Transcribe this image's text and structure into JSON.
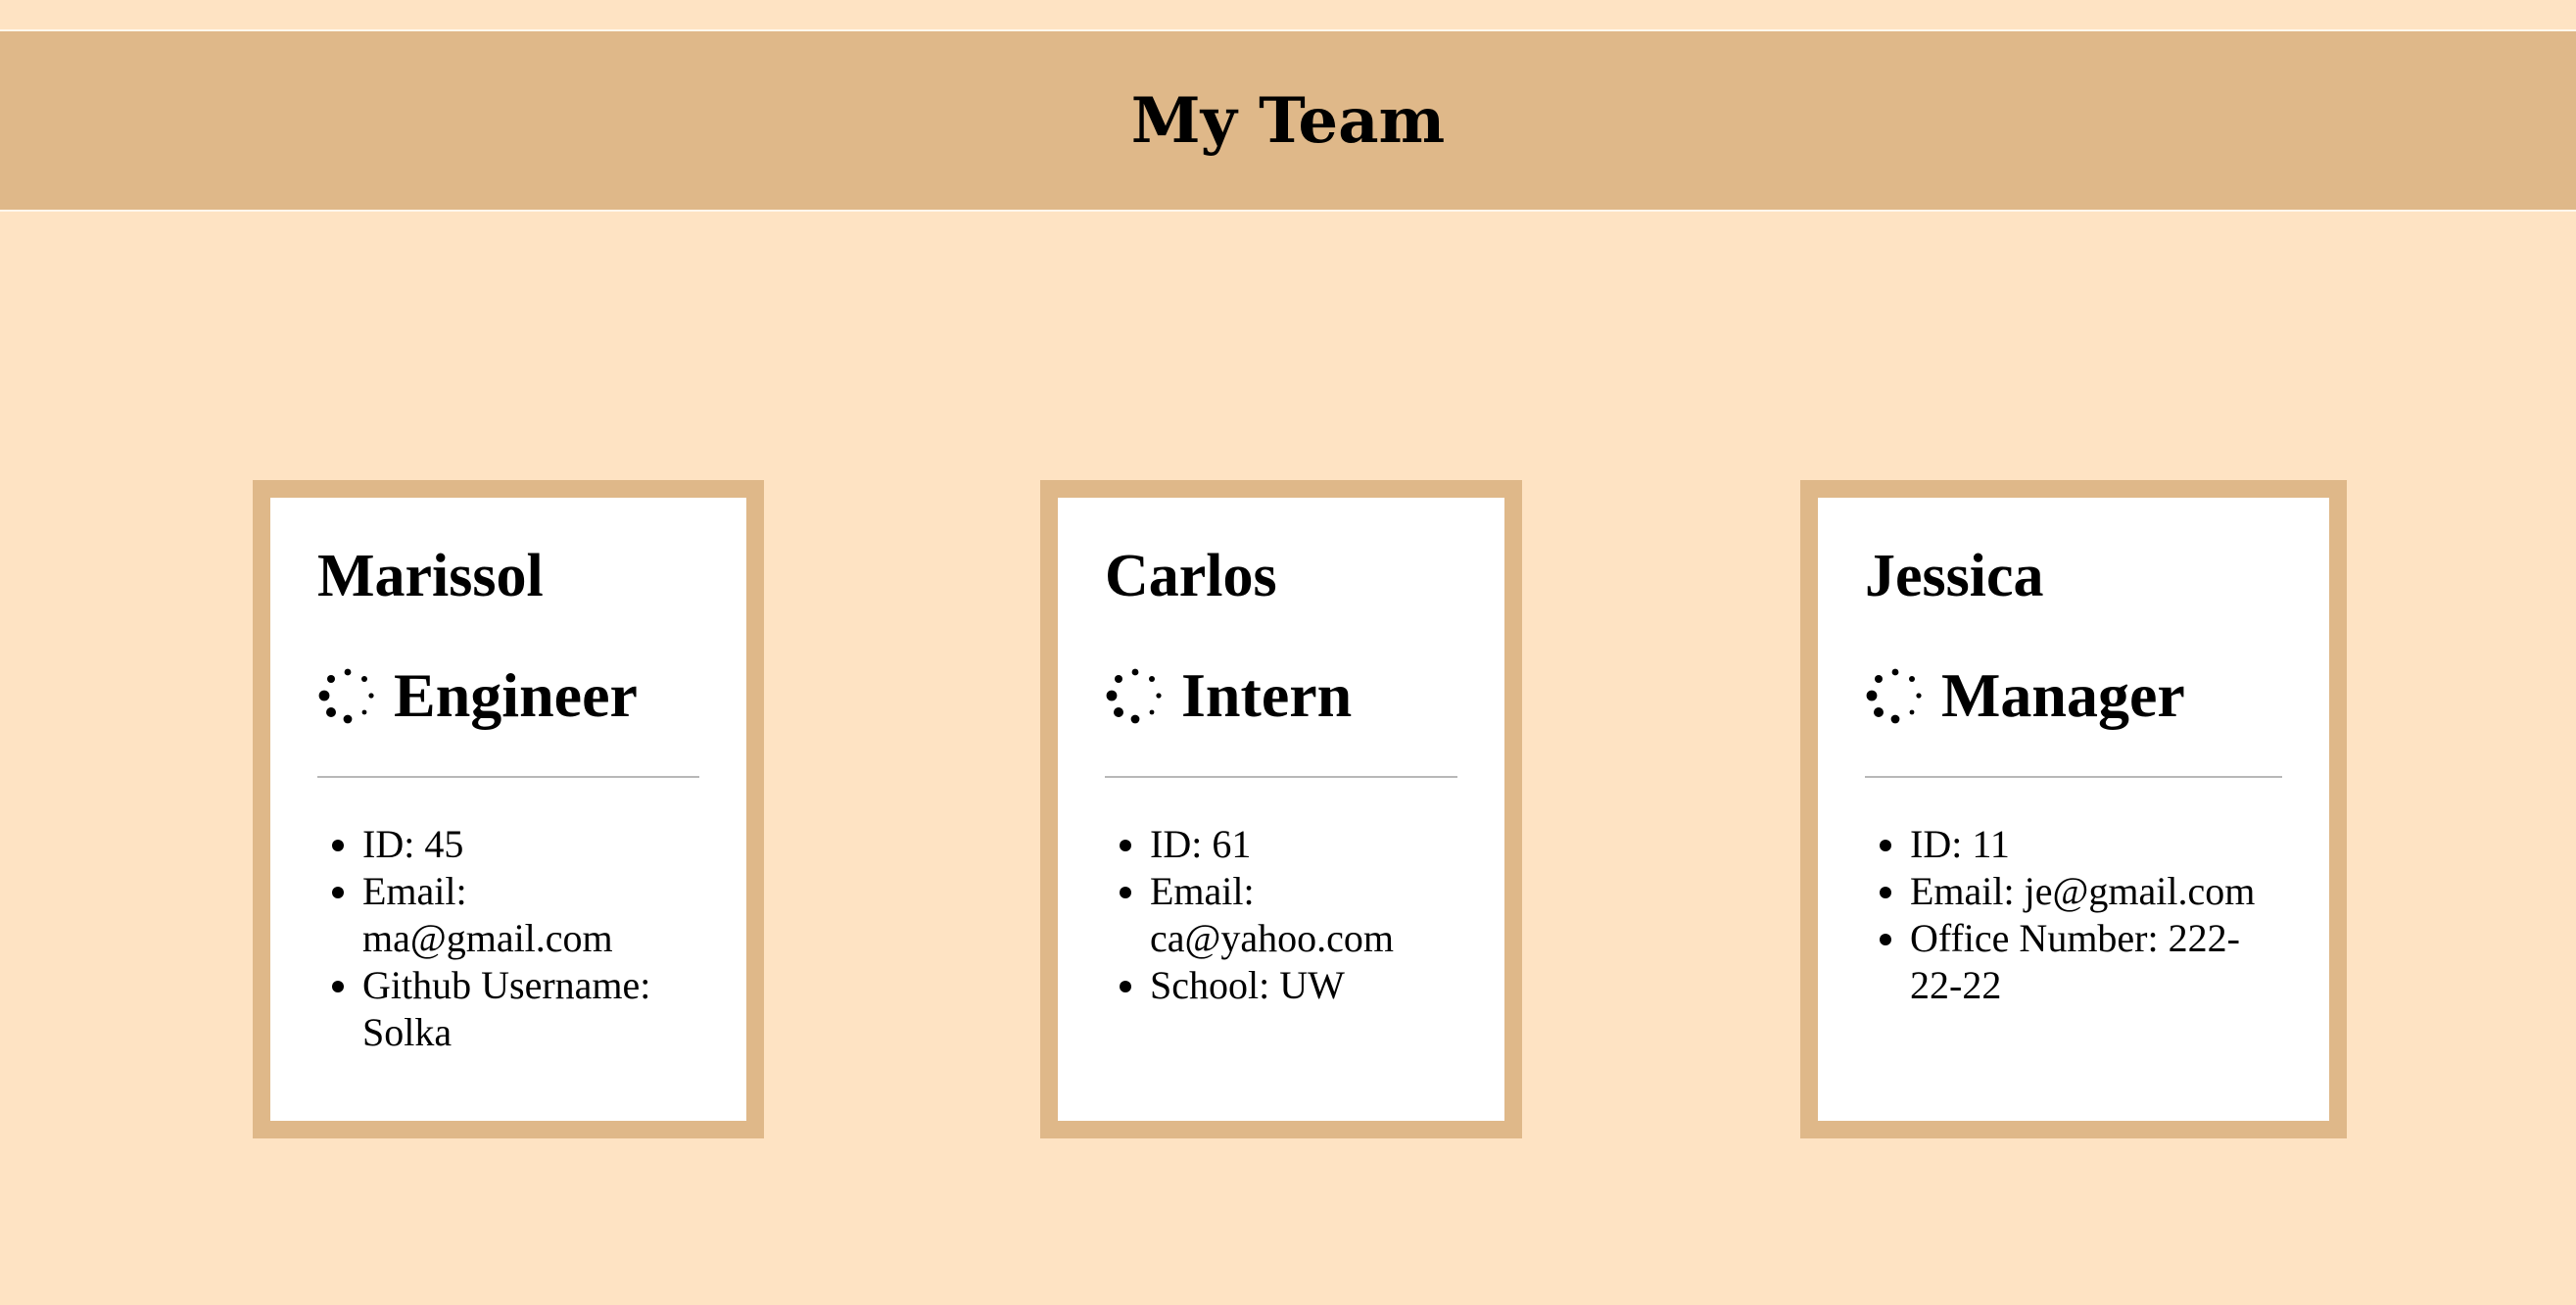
{
  "page": {
    "title": "My Team"
  },
  "colors": {
    "background": "#fee3c3",
    "header": "#dfb889",
    "card_border": "#dfb889",
    "card_background": "#ffffff"
  },
  "team": [
    {
      "name": "Marissol",
      "role": "Engineer",
      "role_icon": "loading-spinner-icon",
      "details": [
        {
          "label": "ID: ",
          "value": "45"
        },
        {
          "label": "Email: ",
          "value": "ma@gmail.com"
        },
        {
          "label": "Github Username: ",
          "value": "Solka"
        }
      ]
    },
    {
      "name": "Carlos",
      "role": "Intern",
      "role_icon": "loading-spinner-icon",
      "details": [
        {
          "label": "ID: ",
          "value": "61"
        },
        {
          "label": "Email: ",
          "value": "ca@yahoo.com"
        },
        {
          "label": "School: ",
          "value": "UW"
        }
      ]
    },
    {
      "name": "Jessica",
      "role": "Manager",
      "role_icon": "loading-spinner-icon",
      "details": [
        {
          "label": "ID: ",
          "value": "11"
        },
        {
          "label": "Email: ",
          "value": "je@gmail.com"
        },
        {
          "label": "Office Number: ",
          "value": "222-22-22"
        }
      ]
    }
  ]
}
